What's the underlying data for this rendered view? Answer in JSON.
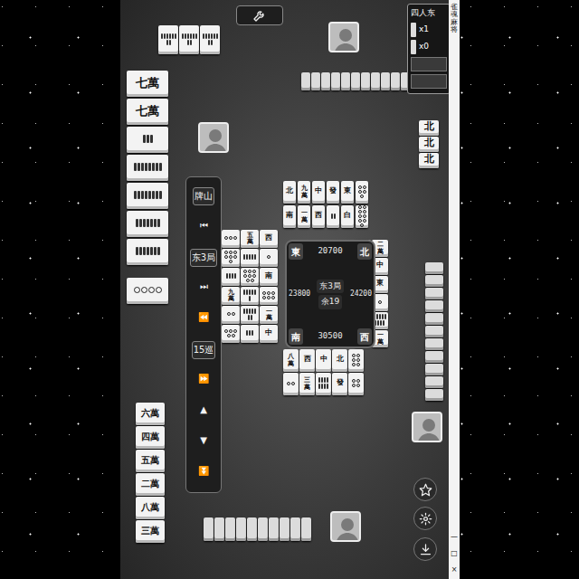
{
  "window": {
    "title": "雀魂麻将",
    "controls": [
      "—",
      "□",
      "×"
    ]
  },
  "score_box": {
    "info": "四人东",
    "counters": [
      {
        "label": "x1"
      },
      {
        "label": "x0"
      }
    ]
  },
  "replay_controls": [
    {
      "label": "牌山"
    },
    {
      "label": "⏮"
    },
    {
      "label": "东3局"
    },
    {
      "label": "⏭"
    },
    {
      "label": "⏪"
    },
    {
      "label": "15巡"
    },
    {
      "label": "⏩"
    },
    {
      "label": "▲"
    },
    {
      "label": "▼"
    },
    {
      "label": "⏬"
    }
  ],
  "center": {
    "round": "东3局",
    "remaining": "余19",
    "scores": {
      "top": "20700",
      "left": "23800",
      "right": "24200",
      "bottom": "30500"
    },
    "winds": {
      "top_left": "東",
      "top_right": "北",
      "bottom_left": "南",
      "bottom_right": "西"
    }
  },
  "hands": {
    "left_meld": [
      {
        "kind": "sou",
        "n": 8
      },
      {
        "kind": "sou",
        "n": 8
      },
      {
        "kind": "sou",
        "n": 8
      }
    ],
    "left_hand": [
      {
        "kind": "man",
        "label": "七萬"
      },
      {
        "kind": "man",
        "label": "七萬"
      },
      {
        "kind": "sou",
        "n": 3
      },
      {
        "kind": "sou",
        "n": 8
      },
      {
        "kind": "sou",
        "n": 8
      },
      {
        "kind": "sou",
        "n": 7
      },
      {
        "kind": "sou",
        "n": 7
      }
    ],
    "left_draw": [
      {
        "kind": "pin",
        "n": 4
      }
    ],
    "bottom_hand": [
      {
        "kind": "man",
        "label": "六萬"
      },
      {
        "kind": "man",
        "label": "四萬"
      },
      {
        "kind": "man",
        "label": "五萬"
      },
      {
        "kind": "man",
        "label": "二萬"
      },
      {
        "kind": "man",
        "label": "八萬"
      },
      {
        "kind": "man",
        "label": "三萬"
      }
    ],
    "right_meld": [
      {
        "kind": "honor",
        "label": "北"
      },
      {
        "kind": "honor",
        "label": "北"
      },
      {
        "kind": "honor",
        "label": "北"
      }
    ]
  },
  "hidden": {
    "top": {
      "count": 12
    },
    "right": {
      "count": 11
    },
    "bottom": {
      "count": 10
    }
  },
  "discards": {
    "top": [
      {
        "kind": "honor",
        "label": "北"
      },
      {
        "kind": "man",
        "label": "九萬"
      },
      {
        "kind": "honor",
        "label": "中"
      },
      {
        "kind": "honor",
        "label": "發"
      },
      {
        "kind": "honor",
        "label": "東"
      },
      {
        "kind": "pin",
        "n": 5
      },
      {
        "kind": "honor",
        "label": "南"
      },
      {
        "kind": "man",
        "label": "一萬"
      },
      {
        "kind": "honor",
        "label": "西"
      },
      {
        "kind": "sou",
        "n": 2
      },
      {
        "kind": "honor",
        "label": "白"
      },
      {
        "kind": "pin",
        "n": 9
      }
    ],
    "left": [
      {
        "kind": "pin",
        "n": 3
      },
      {
        "kind": "man",
        "label": "五萬"
      },
      {
        "kind": "honor",
        "label": "西"
      },
      {
        "kind": "pin",
        "n": 7
      },
      {
        "kind": "sou",
        "n": 5
      },
      {
        "kind": "pin",
        "n": 1
      },
      {
        "kind": "sou",
        "n": 4
      },
      {
        "kind": "pin",
        "n": 8
      },
      {
        "kind": "honor",
        "label": "南"
      },
      {
        "kind": "man",
        "label": "九萬"
      },
      {
        "kind": "sou",
        "n": 6
      },
      {
        "kind": "pin",
        "n": 6
      },
      {
        "kind": "pin",
        "n": 2
      },
      {
        "kind": "sou",
        "n": 7
      },
      {
        "kind": "man",
        "label": "一萬"
      },
      {
        "kind": "pin",
        "n": 5
      },
      {
        "kind": "sou",
        "n": 3
      },
      {
        "kind": "honor",
        "label": "中"
      }
    ],
    "right": [
      {
        "kind": "honor",
        "label": "西"
      },
      {
        "kind": "man",
        "label": "二萬"
      },
      {
        "kind": "honor",
        "label": "北"
      },
      {
        "kind": "honor",
        "label": "中"
      },
      {
        "kind": "honor",
        "label": "發"
      },
      {
        "kind": "honor",
        "label": "東"
      },
      {
        "kind": "man",
        "label": "九萬"
      },
      {
        "kind": "pin",
        "n": 1
      },
      {
        "kind": "honor",
        "label": "中"
      },
      {
        "kind": "sou",
        "n": 9
      },
      {
        "kind": "honor",
        "label": "白"
      },
      {
        "kind": "man",
        "label": "一萬"
      }
    ],
    "bottom": [
      {
        "kind": "man",
        "label": "八萬"
      },
      {
        "kind": "honor",
        "label": "西"
      },
      {
        "kind": "honor",
        "label": "中"
      },
      {
        "kind": "honor",
        "label": "北"
      },
      {
        "kind": "pin",
        "n": 6
      },
      {
        "kind": "pin",
        "n": 2
      },
      {
        "kind": "man",
        "label": "三萬"
      },
      {
        "kind": "sou",
        "n": 8
      },
      {
        "kind": "honor",
        "label": "發"
      },
      {
        "kind": "pin",
        "n": 4
      }
    ]
  }
}
